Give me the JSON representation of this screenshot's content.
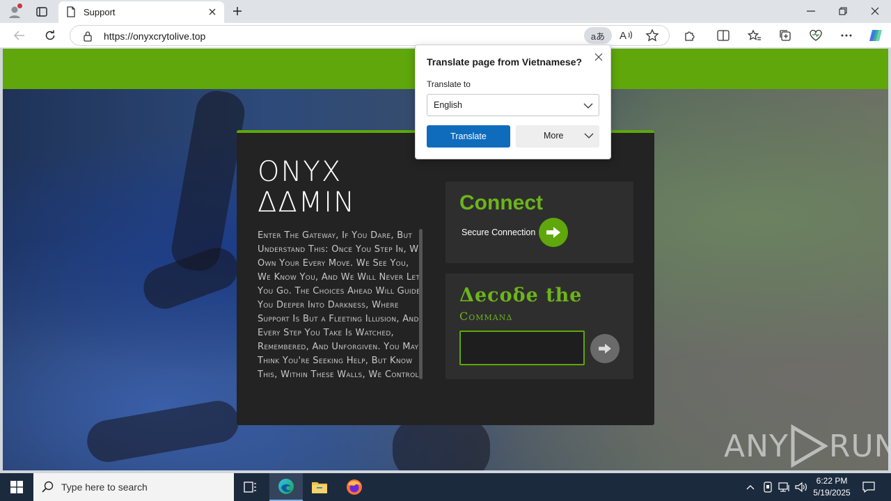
{
  "browser": {
    "tab_title": "Support",
    "url": "https://onyxcrytolive.top",
    "translate_pill": "aあ"
  },
  "page": {
    "brand_line1": "ONYX",
    "brand_line2": "ΔΔMIN",
    "intro": "Enter The Gateway, If You Dare, But Understand This: Once You Step In, We Own Your Every Move. We See You, We Know You, And We Will Never Let You Go. The Choices Ahead Will Guide You Deeper Into Darkness, Where Support Is But a Fleeting Illusion, And Every Step You Take Is Watched, Remembered, And Unforgiven. You May Think You're Seeking Help, But Know This, Within These Walls, We Control",
    "connect_title": "Connect",
    "connect_sub": "Secure Connection",
    "decode_title": "Δecoδe the",
    "decode_sub": "Commanδ",
    "command_value": ""
  },
  "translate_popup": {
    "title": "Translate page from Vietnamese?",
    "label": "Translate to",
    "selected_language": "English",
    "translate_button": "Translate",
    "more_button": "More"
  },
  "watermark": {
    "left": "ANY",
    "right": "RUN"
  },
  "taskbar": {
    "search_placeholder": "Type here to search",
    "time": "6:22 PM",
    "date": "5/19/2025"
  },
  "colors": {
    "accent_green": "#5fa70a",
    "edge_blue": "#0f6cbd",
    "panel": "#232323"
  }
}
